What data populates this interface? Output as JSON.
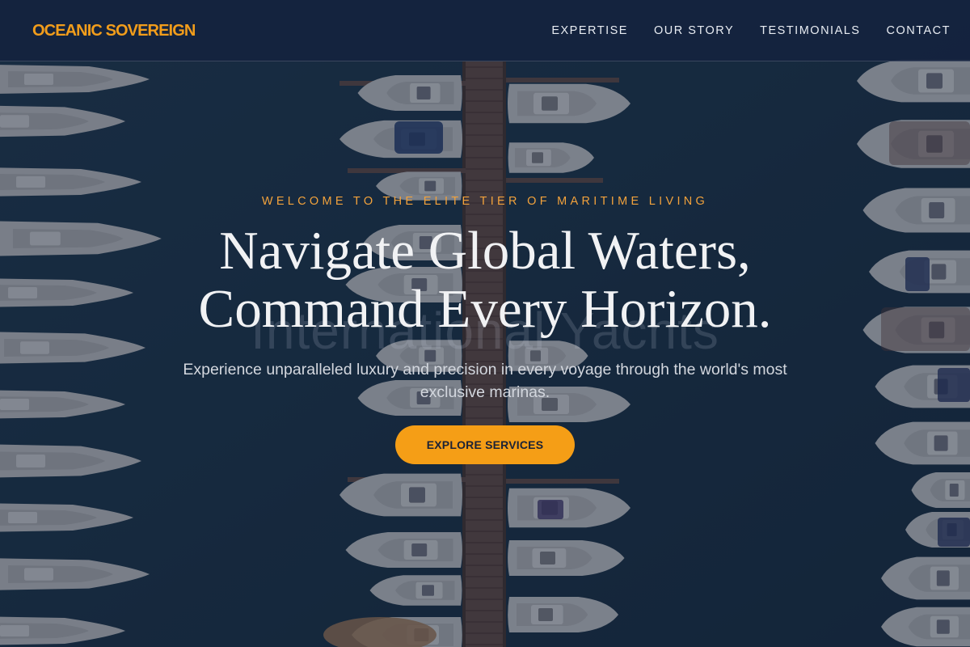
{
  "brand": {
    "name": "OCEANIC SOVEREIGN",
    "accent_color": "#f29d1b"
  },
  "nav": {
    "items": [
      {
        "label": "EXPERTISE"
      },
      {
        "label": "OUR STORY"
      },
      {
        "label": "TESTIMONIALS"
      },
      {
        "label": "CONTACT"
      }
    ]
  },
  "hero": {
    "eyebrow": "WELCOME TO THE ELITE TIER OF MARITIME LIVING",
    "headline_line1": "Navigate Global Waters,",
    "headline_line2": "Command Every Horizon.",
    "watermark": "International Yachts",
    "subtitle": "Experience unparalleled luxury and precision in every voyage through the world's most exclusive marinas.",
    "cta_label": "EXPLORE SERVICES",
    "background_image": "aerial-marina-yachts",
    "cta_color": "#f59e16"
  }
}
